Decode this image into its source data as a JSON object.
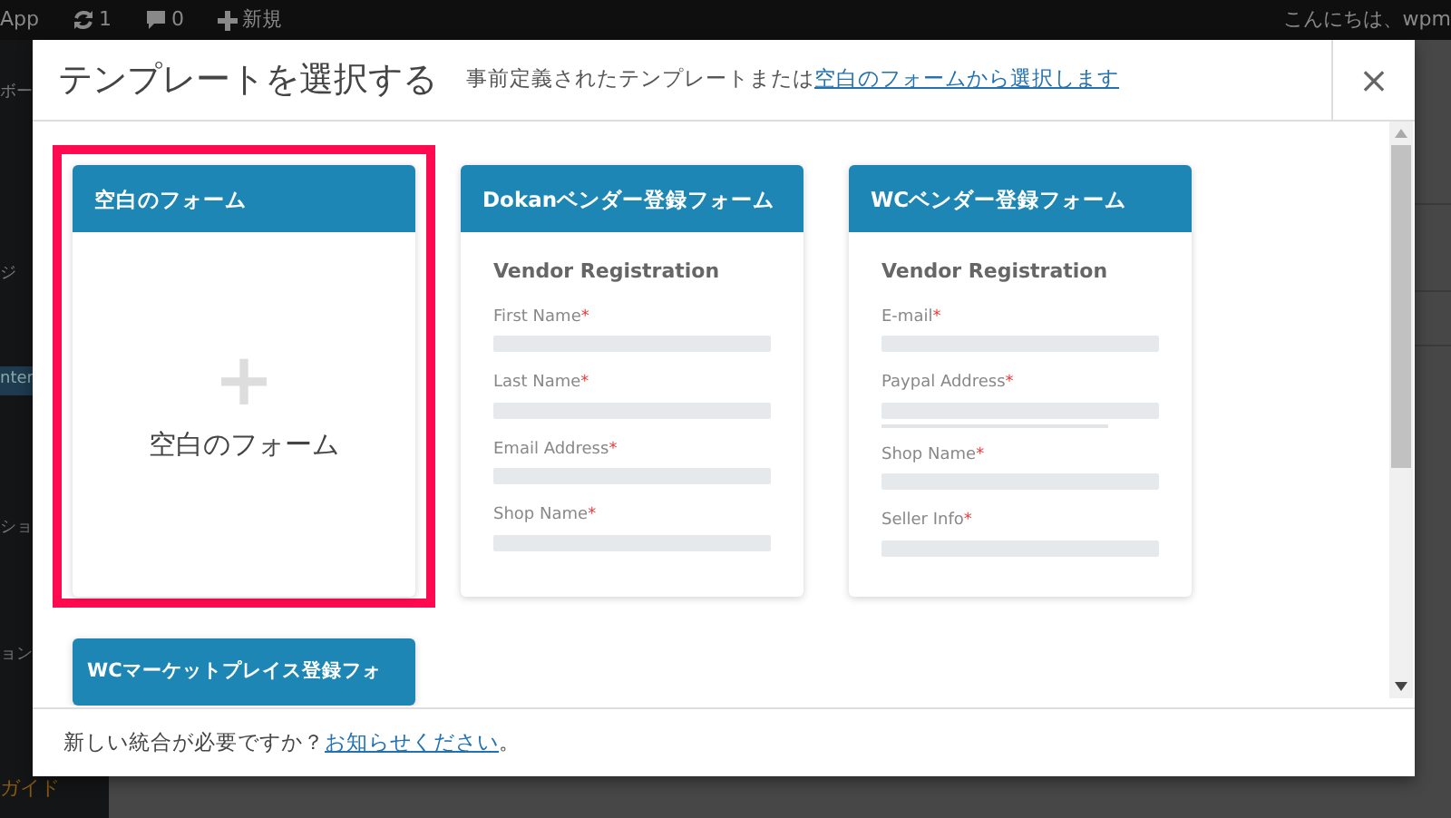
{
  "admin_bar": {
    "items": [
      {
        "kind": "text",
        "label": "App"
      },
      {
        "kind": "updates",
        "label": "1"
      },
      {
        "kind": "comments",
        "label": "0"
      },
      {
        "kind": "new",
        "label": "新規"
      }
    ],
    "greeting": "こんにちは、wpm"
  },
  "sidebar": {
    "items": [
      {
        "label": "ボー",
        "selected": false
      },
      {
        "label": "ジ",
        "selected": false
      },
      {
        "label": "nter",
        "selected": true
      },
      {
        "label": "ショ",
        "selected": false
      },
      {
        "label": "ョン",
        "selected": false
      },
      {
        "label": "ガイド",
        "selected": false,
        "kind": "highlight"
      }
    ]
  },
  "modal": {
    "title": "テンプレートを選択する",
    "subtitle": "事前定義されたテンプレートまたは",
    "subtitle_link": "空白のフォームから選択します",
    "close": "×",
    "templates": [
      {
        "kind": "blank",
        "title": "空白のフォーム",
        "selected": true,
        "plus": "+",
        "label": "空白のフォーム"
      },
      {
        "kind": "preview",
        "title": "Dokanベンダー登録フォーム",
        "selected": false,
        "form_title": "Vendor Registration",
        "fields": [
          {
            "label": "First Name",
            "mark": "*"
          },
          {
            "label": "Last Name",
            "mark": "*"
          },
          {
            "label": "Email Address",
            "mark": "*"
          },
          {
            "label": "Shop Name",
            "mark": "*"
          }
        ]
      },
      {
        "kind": "preview",
        "title": "WCベンダー登録フォーム",
        "selected": false,
        "form_title": "Vendor Registration",
        "fields": [
          {
            "label": "E-mail",
            "mark": "*"
          },
          {
            "label": "Paypal Address",
            "mark": "*",
            "kind": "hint"
          },
          {
            "label": "Shop Name",
            "mark": "*"
          },
          {
            "label": "Seller Info",
            "mark": "*"
          }
        ]
      },
      {
        "kind": "cut",
        "title": "WCマーケットプレイス登録フォ",
        "selected": false
      }
    ],
    "footer": {
      "text": "新しい統合が必要ですか？",
      "link": "お知らせください",
      "end": "。"
    }
  }
}
